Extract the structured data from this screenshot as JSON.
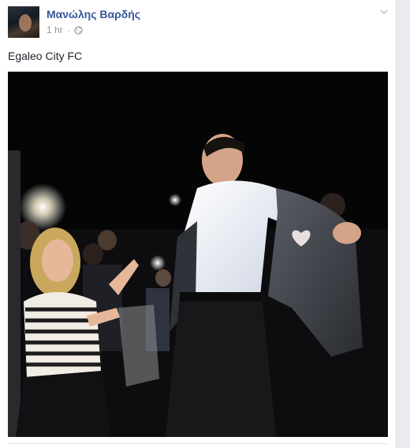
{
  "post": {
    "author": "Μανώλης Βαρδής",
    "timestamp": "1 hr",
    "separator": "·",
    "privacy_icon": "globe-icon",
    "menu_icon": "chevron-down-icon",
    "text": "Egaleo City FC"
  },
  "colors": {
    "author_link": "#365899",
    "meta_gray": "#90949c",
    "page_bg": "#e9ebee",
    "card_bg": "#ffffff"
  }
}
